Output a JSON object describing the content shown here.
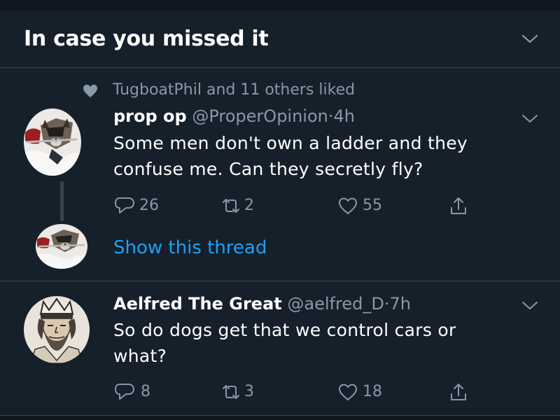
{
  "section": {
    "title": "In case you missed it"
  },
  "tweets": [
    {
      "social_context": "TugboatPhil and 11 others liked",
      "name": "prop op",
      "handle": "@ProperOpinion",
      "separator": "·",
      "time": "4h",
      "text_lines": [
        "Some men don't own a ladder and they",
        "confuse me.  Can they secretly fly?"
      ],
      "replies": "26",
      "retweets": "2",
      "likes": "55",
      "show_thread": "Show this thread"
    },
    {
      "name": "Aelfred The Great",
      "handle": "@aelfred_D",
      "separator": "·",
      "time": "7h",
      "text_lines": [
        "So do dogs get that we control cars or",
        "what?"
      ],
      "replies": "8",
      "retweets": "3",
      "likes": "18"
    }
  ],
  "icons": {
    "header_caret": "chevron-down-icon",
    "social": "heart-icon",
    "reply": "reply-icon",
    "retweet": "retweet-icon",
    "like": "heart-outline-icon",
    "share": "share-icon"
  },
  "colors": {
    "background": "#15202b",
    "accent": "#1da1f2",
    "secondary_text": "#8899a6",
    "divider": "#38444d"
  }
}
